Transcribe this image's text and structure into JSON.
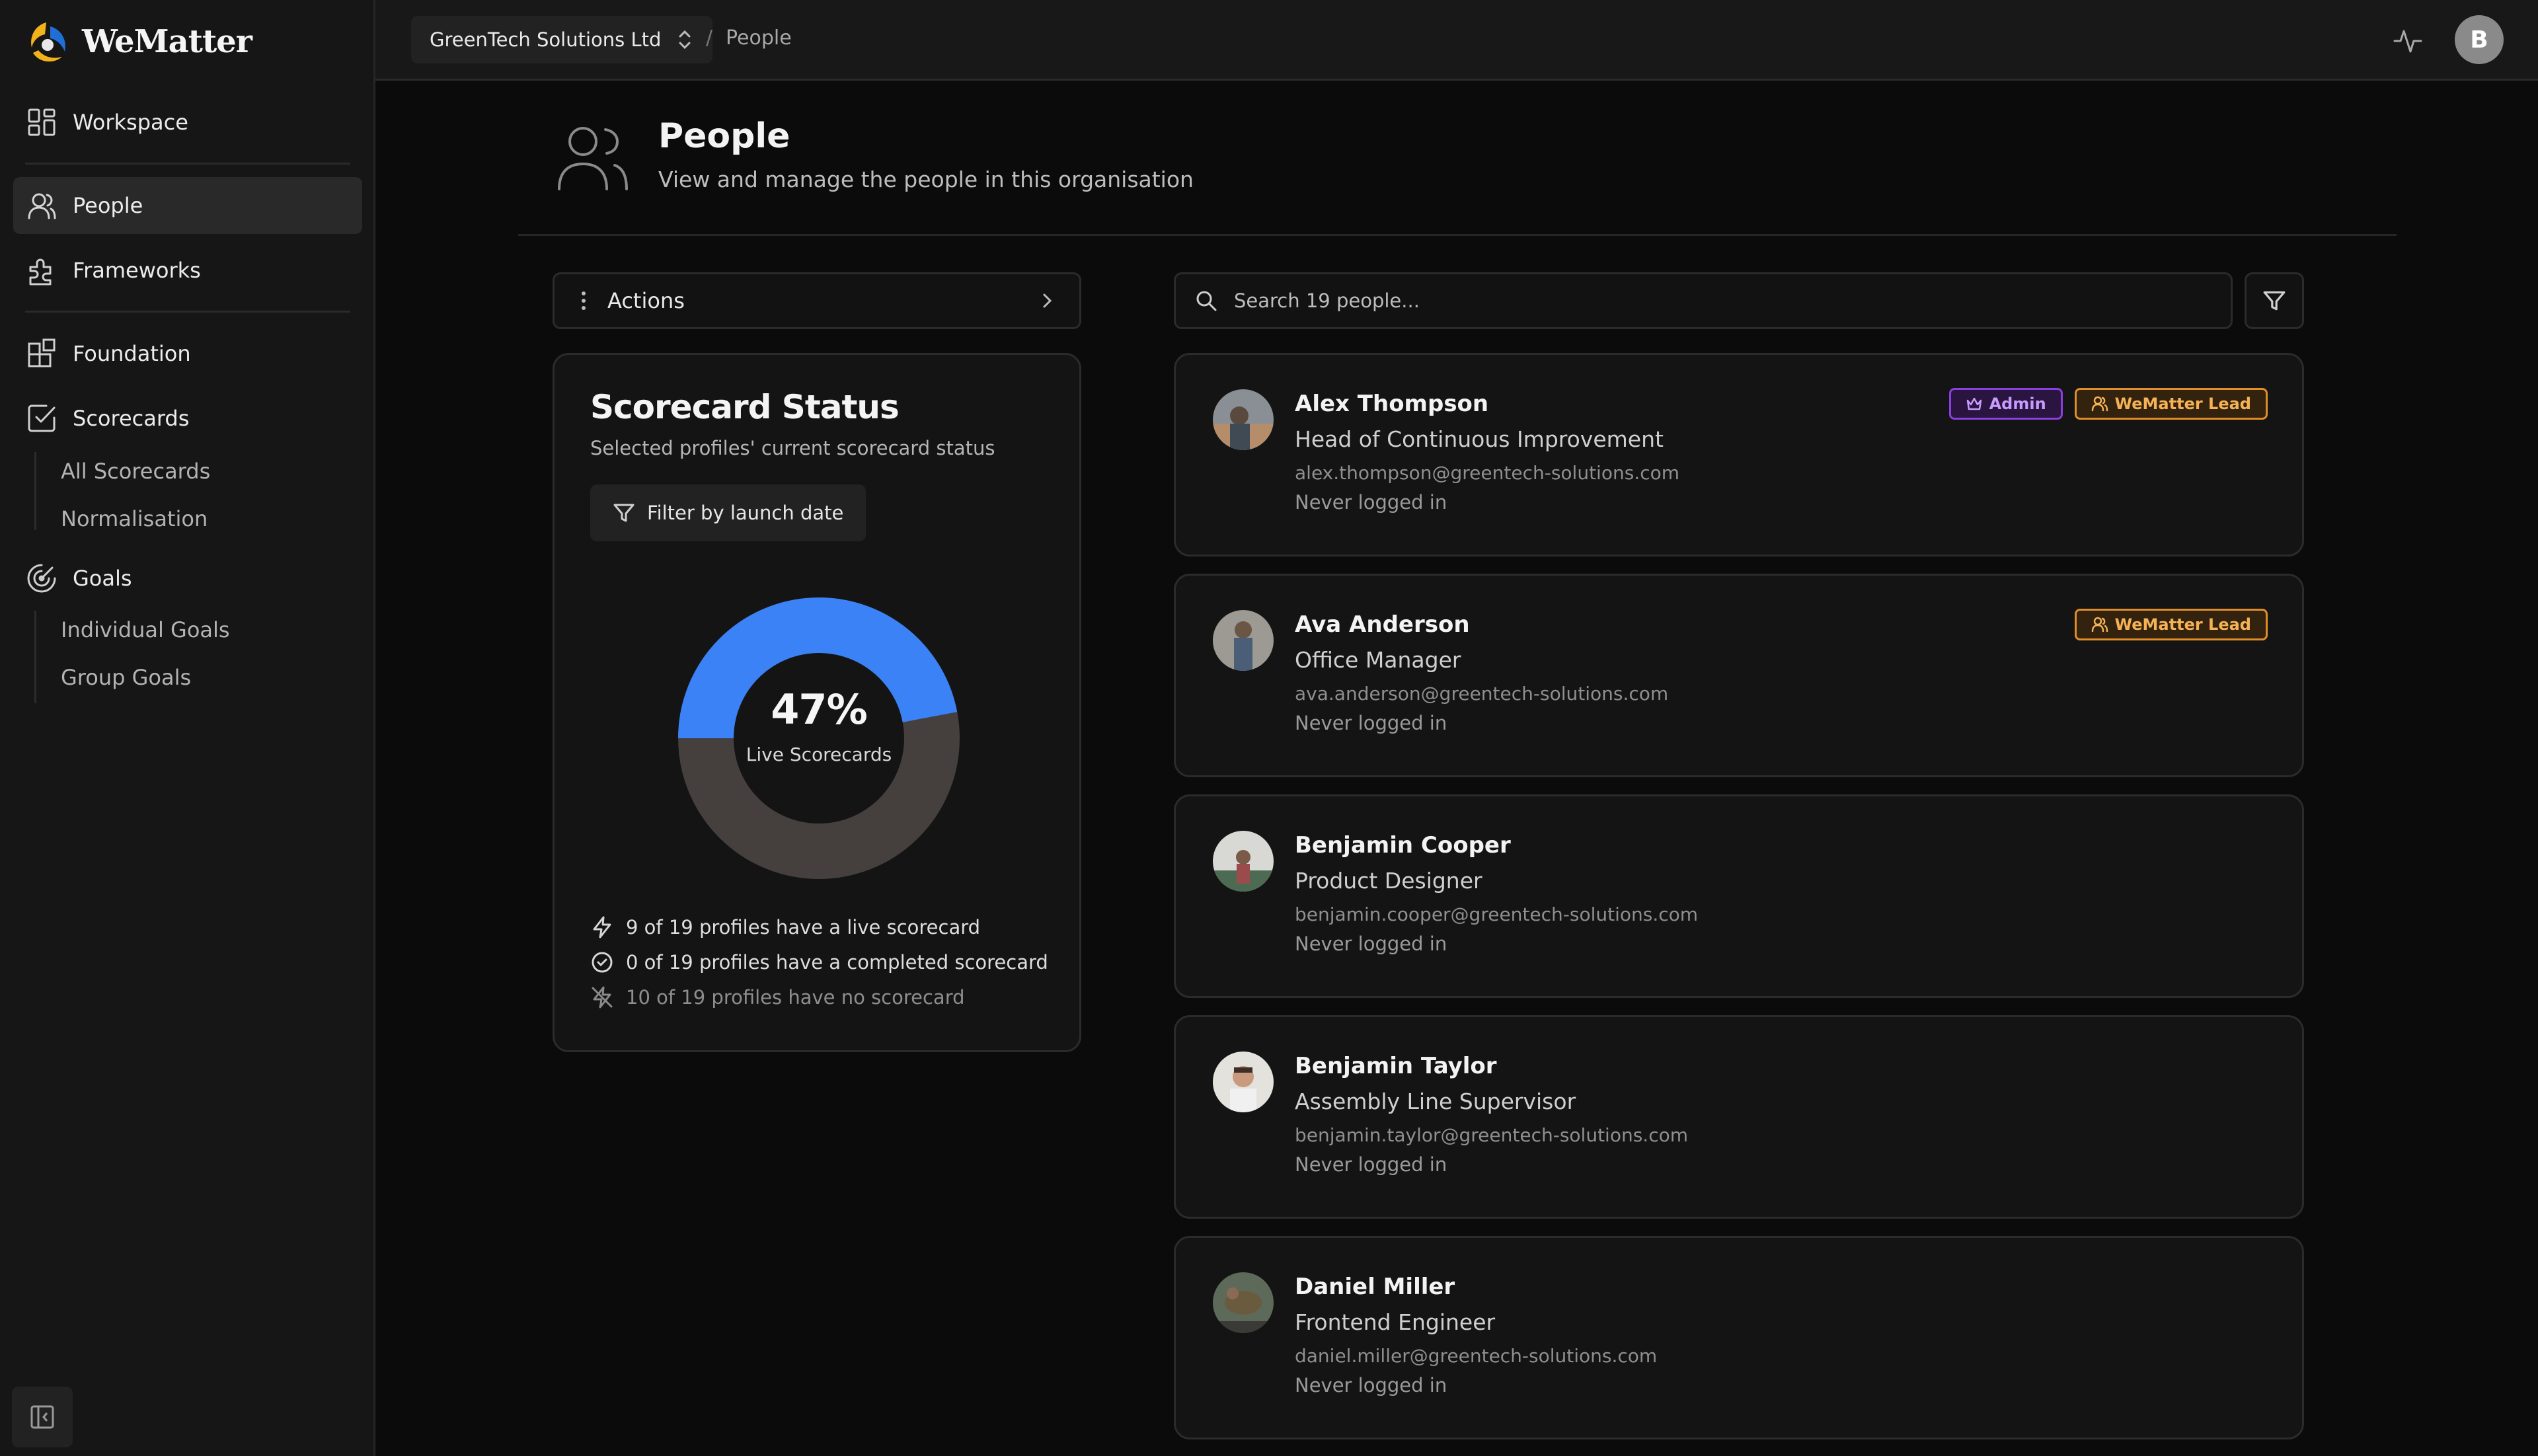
{
  "brand": {
    "name": "WeMatter"
  },
  "sidebar": {
    "items": [
      {
        "label": "Workspace",
        "icon": "grid-icon"
      },
      {
        "label": "People",
        "icon": "users-icon",
        "active": true
      },
      {
        "label": "Frameworks",
        "icon": "puzzle-icon"
      },
      {
        "label": "Foundation",
        "icon": "blocks-icon"
      },
      {
        "label": "Scorecards",
        "icon": "checkbox-icon"
      },
      {
        "label": "Goals",
        "icon": "target-icon"
      }
    ],
    "scorecards_sub": [
      "All Scorecards",
      "Normalisation"
    ],
    "goals_sub": [
      "Individual Goals",
      "Group Goals"
    ]
  },
  "topbar": {
    "org": "GreenTech Solutions Ltd",
    "breadcrumb_sep": "/",
    "breadcrumb": "People",
    "user_initial": "B"
  },
  "header": {
    "title": "People",
    "subtitle": "View and manage the people in this organisation"
  },
  "actions": {
    "label": "Actions"
  },
  "status": {
    "title": "Scorecard Status",
    "subtitle": "Selected profiles' current scorecard status",
    "filter_label": "Filter by launch date",
    "percent_label": "47%",
    "center_label": "Live Scorecards",
    "live_fraction": 0.47,
    "colors": {
      "live": "#3b82f6",
      "rest": "#45403e"
    },
    "stats": [
      "9 of 19 profiles have a live scorecard",
      "0 of 19 profiles have a completed scorecard",
      "10 of 19 profiles have no scorecard"
    ]
  },
  "search": {
    "placeholder": "Search 19 people..."
  },
  "people": [
    {
      "name": "Alex Thompson",
      "role": "Head of Continuous Improvement",
      "email": "alex.thompson@greentech-solutions.com",
      "login": "Never logged in",
      "badges": {
        "admin": "Admin",
        "lead": "WeMatter Lead"
      }
    },
    {
      "name": "Ava Anderson",
      "role": "Office Manager",
      "email": "ava.anderson@greentech-solutions.com",
      "login": "Never logged in",
      "badges": {
        "lead": "WeMatter Lead"
      }
    },
    {
      "name": "Benjamin Cooper",
      "role": "Product Designer",
      "email": "benjamin.cooper@greentech-solutions.com",
      "login": "Never logged in"
    },
    {
      "name": "Benjamin Taylor",
      "role": "Assembly Line Supervisor",
      "email": "benjamin.taylor@greentech-solutions.com",
      "login": "Never logged in"
    },
    {
      "name": "Daniel Miller",
      "role": "Frontend Engineer",
      "email": "daniel.miller@greentech-solutions.com",
      "login": "Never logged in"
    }
  ]
}
